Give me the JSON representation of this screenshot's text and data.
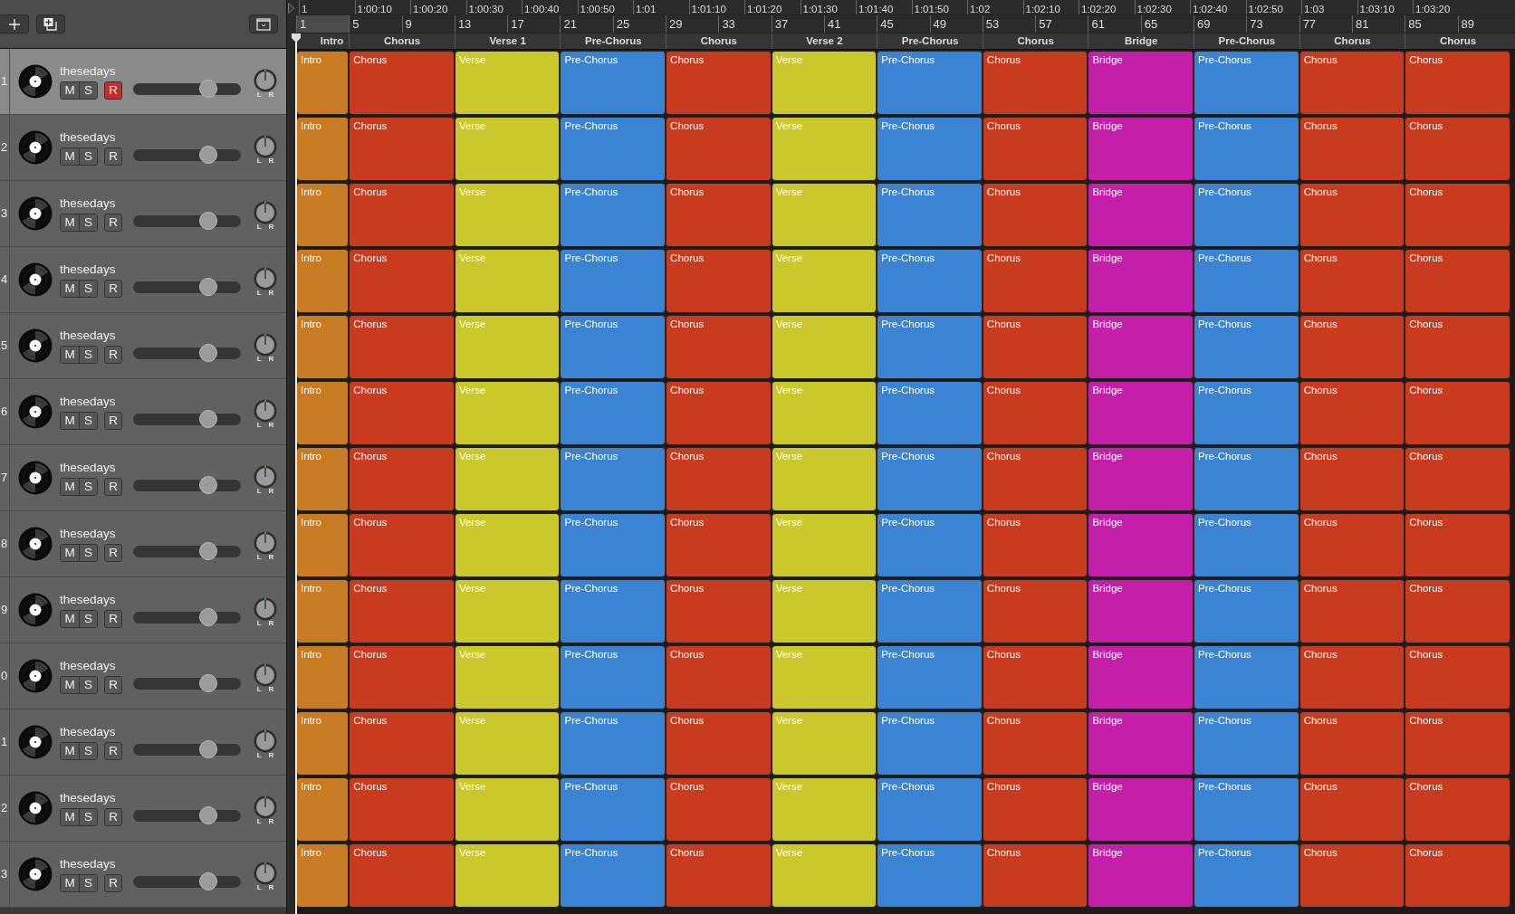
{
  "ruler": {
    "times": [
      "1",
      "1:00:10",
      "1:00:20",
      "1:00:30",
      "1:00:40",
      "1:00:50",
      "1:01",
      "1:01:10",
      "1:01:20",
      "1:01:30",
      "1:01:40",
      "1:01:50",
      "1:02",
      "1:02:10",
      "1:02:20",
      "1:02:30",
      "1:02:40",
      "1:02:50",
      "1:03",
      "1:03:10",
      "1:03:20"
    ],
    "bars": [
      "1",
      "5",
      "9",
      "13",
      "17",
      "21",
      "25",
      "29",
      "33",
      "37",
      "41",
      "45",
      "49",
      "53",
      "57",
      "61",
      "65",
      "69",
      "73",
      "77",
      "81",
      "85",
      "89"
    ]
  },
  "markers": [
    {
      "label": "Intro"
    },
    {
      "label": "Chorus"
    },
    {
      "label": "Verse 1"
    },
    {
      "label": "Pre-Chorus"
    },
    {
      "label": "Chorus"
    },
    {
      "label": "Verse 2"
    },
    {
      "label": "Pre-Chorus"
    },
    {
      "label": "Chorus"
    },
    {
      "label": "Bridge"
    },
    {
      "label": "Pre-Chorus"
    },
    {
      "label": "Chorus"
    },
    {
      "label": "Chorus"
    }
  ],
  "tracks": [
    {
      "number": "1",
      "name": "thesedays",
      "selected": true,
      "mute": {
        "label": "M",
        "on": false
      },
      "solo": {
        "label": "S",
        "on": false
      },
      "record": {
        "label": "R",
        "on": true
      },
      "volume": {
        "level": 0.7
      },
      "pan": {
        "left": "L",
        "right": "R"
      },
      "regions": [
        {
          "label": "Intro",
          "color": "#c87b22"
        },
        {
          "label": "Chorus",
          "color": "#c83b1e"
        },
        {
          "label": "Verse",
          "color": "#cbc82e"
        },
        {
          "label": "Pre-Chorus",
          "color": "#3a84d3"
        },
        {
          "label": "Chorus",
          "color": "#c83b1e"
        },
        {
          "label": "Verse",
          "color": "#cbc82e"
        },
        {
          "label": "Pre-Chorus",
          "color": "#3a84d3"
        },
        {
          "label": "Chorus",
          "color": "#c83b1e"
        },
        {
          "label": "Bridge",
          "color": "#c41fa8"
        },
        {
          "label": "Pre-Chorus",
          "color": "#3a84d3"
        },
        {
          "label": "Chorus",
          "color": "#c83b1e"
        },
        {
          "label": "Chorus",
          "color": "#c83b1e"
        }
      ]
    },
    {
      "number": "2",
      "name": "thesedays",
      "selected": false,
      "mute": {
        "label": "M",
        "on": false
      },
      "solo": {
        "label": "S",
        "on": false
      },
      "record": {
        "label": "R",
        "on": false
      },
      "volume": {
        "level": 0.7
      },
      "pan": {
        "left": "L",
        "right": "R"
      },
      "regions": [
        {
          "label": "Intro",
          "color": "#c87b22"
        },
        {
          "label": "Chorus",
          "color": "#c83b1e"
        },
        {
          "label": "Verse",
          "color": "#cbc82e"
        },
        {
          "label": "Pre-Chorus",
          "color": "#3a84d3"
        },
        {
          "label": "Chorus",
          "color": "#c83b1e"
        },
        {
          "label": "Verse",
          "color": "#cbc82e"
        },
        {
          "label": "Pre-Chorus",
          "color": "#3a84d3"
        },
        {
          "label": "Chorus",
          "color": "#c83b1e"
        },
        {
          "label": "Bridge",
          "color": "#c41fa8"
        },
        {
          "label": "Pre-Chorus",
          "color": "#3a84d3"
        },
        {
          "label": "Chorus",
          "color": "#c83b1e"
        },
        {
          "label": "Chorus",
          "color": "#c83b1e"
        }
      ]
    },
    {
      "number": "3",
      "name": "thesedays",
      "selected": false,
      "mute": {
        "label": "M",
        "on": false
      },
      "solo": {
        "label": "S",
        "on": false
      },
      "record": {
        "label": "R",
        "on": false
      },
      "volume": {
        "level": 0.7
      },
      "pan": {
        "left": "L",
        "right": "R"
      },
      "regions": [
        {
          "label": "Intro",
          "color": "#c87b22"
        },
        {
          "label": "Chorus",
          "color": "#c83b1e"
        },
        {
          "label": "Verse",
          "color": "#cbc82e"
        },
        {
          "label": "Pre-Chorus",
          "color": "#3a84d3"
        },
        {
          "label": "Chorus",
          "color": "#c83b1e"
        },
        {
          "label": "Verse",
          "color": "#cbc82e"
        },
        {
          "label": "Pre-Chorus",
          "color": "#3a84d3"
        },
        {
          "label": "Chorus",
          "color": "#c83b1e"
        },
        {
          "label": "Bridge",
          "color": "#c41fa8"
        },
        {
          "label": "Pre-Chorus",
          "color": "#3a84d3"
        },
        {
          "label": "Chorus",
          "color": "#c83b1e"
        },
        {
          "label": "Chorus",
          "color": "#c83b1e"
        }
      ]
    },
    {
      "number": "4",
      "name": "thesedays",
      "selected": false,
      "mute": {
        "label": "M",
        "on": false
      },
      "solo": {
        "label": "S",
        "on": false
      },
      "record": {
        "label": "R",
        "on": false
      },
      "volume": {
        "level": 0.7
      },
      "pan": {
        "left": "L",
        "right": "R"
      },
      "regions": [
        {
          "label": "Intro",
          "color": "#c87b22"
        },
        {
          "label": "Chorus",
          "color": "#c83b1e"
        },
        {
          "label": "Verse",
          "color": "#cbc82e"
        },
        {
          "label": "Pre-Chorus",
          "color": "#3a84d3"
        },
        {
          "label": "Chorus",
          "color": "#c83b1e"
        },
        {
          "label": "Verse",
          "color": "#cbc82e"
        },
        {
          "label": "Pre-Chorus",
          "color": "#3a84d3"
        },
        {
          "label": "Chorus",
          "color": "#c83b1e"
        },
        {
          "label": "Bridge",
          "color": "#c41fa8"
        },
        {
          "label": "Pre-Chorus",
          "color": "#3a84d3"
        },
        {
          "label": "Chorus",
          "color": "#c83b1e"
        },
        {
          "label": "Chorus",
          "color": "#c83b1e"
        }
      ]
    },
    {
      "number": "5",
      "name": "thesedays",
      "selected": false,
      "mute": {
        "label": "M",
        "on": false
      },
      "solo": {
        "label": "S",
        "on": false
      },
      "record": {
        "label": "R",
        "on": false
      },
      "volume": {
        "level": 0.7
      },
      "pan": {
        "left": "L",
        "right": "R"
      },
      "regions": [
        {
          "label": "Intro",
          "color": "#c87b22"
        },
        {
          "label": "Chorus",
          "color": "#c83b1e"
        },
        {
          "label": "Verse",
          "color": "#cbc82e"
        },
        {
          "label": "Pre-Chorus",
          "color": "#3a84d3"
        },
        {
          "label": "Chorus",
          "color": "#c83b1e"
        },
        {
          "label": "Verse",
          "color": "#cbc82e"
        },
        {
          "label": "Pre-Chorus",
          "color": "#3a84d3"
        },
        {
          "label": "Chorus",
          "color": "#c83b1e"
        },
        {
          "label": "Bridge",
          "color": "#c41fa8"
        },
        {
          "label": "Pre-Chorus",
          "color": "#3a84d3"
        },
        {
          "label": "Chorus",
          "color": "#c83b1e"
        },
        {
          "label": "Chorus",
          "color": "#c83b1e"
        }
      ]
    },
    {
      "number": "6",
      "name": "thesedays",
      "selected": false,
      "mute": {
        "label": "M",
        "on": false
      },
      "solo": {
        "label": "S",
        "on": false
      },
      "record": {
        "label": "R",
        "on": false
      },
      "volume": {
        "level": 0.7
      },
      "pan": {
        "left": "L",
        "right": "R"
      },
      "regions": [
        {
          "label": "Intro",
          "color": "#c87b22"
        },
        {
          "label": "Chorus",
          "color": "#c83b1e"
        },
        {
          "label": "Verse",
          "color": "#cbc82e"
        },
        {
          "label": "Pre-Chorus",
          "color": "#3a84d3"
        },
        {
          "label": "Chorus",
          "color": "#c83b1e"
        },
        {
          "label": "Verse",
          "color": "#cbc82e"
        },
        {
          "label": "Pre-Chorus",
          "color": "#3a84d3"
        },
        {
          "label": "Chorus",
          "color": "#c83b1e"
        },
        {
          "label": "Bridge",
          "color": "#c41fa8"
        },
        {
          "label": "Pre-Chorus",
          "color": "#3a84d3"
        },
        {
          "label": "Chorus",
          "color": "#c83b1e"
        },
        {
          "label": "Chorus",
          "color": "#c83b1e"
        }
      ]
    },
    {
      "number": "7",
      "name": "thesedays",
      "selected": false,
      "mute": {
        "label": "M",
        "on": false
      },
      "solo": {
        "label": "S",
        "on": false
      },
      "record": {
        "label": "R",
        "on": false
      },
      "volume": {
        "level": 0.7
      },
      "pan": {
        "left": "L",
        "right": "R"
      },
      "regions": [
        {
          "label": "Intro",
          "color": "#c87b22"
        },
        {
          "label": "Chorus",
          "color": "#c83b1e"
        },
        {
          "label": "Verse",
          "color": "#cbc82e"
        },
        {
          "label": "Pre-Chorus",
          "color": "#3a84d3"
        },
        {
          "label": "Chorus",
          "color": "#c83b1e"
        },
        {
          "label": "Verse",
          "color": "#cbc82e"
        },
        {
          "label": "Pre-Chorus",
          "color": "#3a84d3"
        },
        {
          "label": "Chorus",
          "color": "#c83b1e"
        },
        {
          "label": "Bridge",
          "color": "#c41fa8"
        },
        {
          "label": "Pre-Chorus",
          "color": "#3a84d3"
        },
        {
          "label": "Chorus",
          "color": "#c83b1e"
        },
        {
          "label": "Chorus",
          "color": "#c83b1e"
        }
      ]
    },
    {
      "number": "8",
      "name": "thesedays",
      "selected": false,
      "mute": {
        "label": "M",
        "on": false
      },
      "solo": {
        "label": "S",
        "on": false
      },
      "record": {
        "label": "R",
        "on": false
      },
      "volume": {
        "level": 0.7
      },
      "pan": {
        "left": "L",
        "right": "R"
      },
      "regions": [
        {
          "label": "Intro",
          "color": "#c87b22"
        },
        {
          "label": "Chorus",
          "color": "#c83b1e"
        },
        {
          "label": "Verse",
          "color": "#cbc82e"
        },
        {
          "label": "Pre-Chorus",
          "color": "#3a84d3"
        },
        {
          "label": "Chorus",
          "color": "#c83b1e"
        },
        {
          "label": "Verse",
          "color": "#cbc82e"
        },
        {
          "label": "Pre-Chorus",
          "color": "#3a84d3"
        },
        {
          "label": "Chorus",
          "color": "#c83b1e"
        },
        {
          "label": "Bridge",
          "color": "#c41fa8"
        },
        {
          "label": "Pre-Chorus",
          "color": "#3a84d3"
        },
        {
          "label": "Chorus",
          "color": "#c83b1e"
        },
        {
          "label": "Chorus",
          "color": "#c83b1e"
        }
      ]
    },
    {
      "number": "9",
      "name": "thesedays",
      "selected": false,
      "mute": {
        "label": "M",
        "on": false
      },
      "solo": {
        "label": "S",
        "on": false
      },
      "record": {
        "label": "R",
        "on": false
      },
      "volume": {
        "level": 0.7
      },
      "pan": {
        "left": "L",
        "right": "R"
      },
      "regions": [
        {
          "label": "Intro",
          "color": "#c87b22"
        },
        {
          "label": "Chorus",
          "color": "#c83b1e"
        },
        {
          "label": "Verse",
          "color": "#cbc82e"
        },
        {
          "label": "Pre-Chorus",
          "color": "#3a84d3"
        },
        {
          "label": "Chorus",
          "color": "#c83b1e"
        },
        {
          "label": "Verse",
          "color": "#cbc82e"
        },
        {
          "label": "Pre-Chorus",
          "color": "#3a84d3"
        },
        {
          "label": "Chorus",
          "color": "#c83b1e"
        },
        {
          "label": "Bridge",
          "color": "#c41fa8"
        },
        {
          "label": "Pre-Chorus",
          "color": "#3a84d3"
        },
        {
          "label": "Chorus",
          "color": "#c83b1e"
        },
        {
          "label": "Chorus",
          "color": "#c83b1e"
        }
      ]
    },
    {
      "number": "0",
      "name": "thesedays",
      "selected": false,
      "mute": {
        "label": "M",
        "on": false
      },
      "solo": {
        "label": "S",
        "on": false
      },
      "record": {
        "label": "R",
        "on": false
      },
      "volume": {
        "level": 0.7
      },
      "pan": {
        "left": "L",
        "right": "R"
      },
      "regions": [
        {
          "label": "Intro",
          "color": "#c87b22"
        },
        {
          "label": "Chorus",
          "color": "#c83b1e"
        },
        {
          "label": "Verse",
          "color": "#cbc82e"
        },
        {
          "label": "Pre-Chorus",
          "color": "#3a84d3"
        },
        {
          "label": "Chorus",
          "color": "#c83b1e"
        },
        {
          "label": "Verse",
          "color": "#cbc82e"
        },
        {
          "label": "Pre-Chorus",
          "color": "#3a84d3"
        },
        {
          "label": "Chorus",
          "color": "#c83b1e"
        },
        {
          "label": "Bridge",
          "color": "#c41fa8"
        },
        {
          "label": "Pre-Chorus",
          "color": "#3a84d3"
        },
        {
          "label": "Chorus",
          "color": "#c83b1e"
        },
        {
          "label": "Chorus",
          "color": "#c83b1e"
        }
      ]
    },
    {
      "number": "1",
      "name": "thesedays",
      "selected": false,
      "mute": {
        "label": "M",
        "on": false
      },
      "solo": {
        "label": "S",
        "on": false
      },
      "record": {
        "label": "R",
        "on": false
      },
      "volume": {
        "level": 0.7
      },
      "pan": {
        "left": "L",
        "right": "R"
      },
      "regions": [
        {
          "label": "Intro",
          "color": "#c87b22"
        },
        {
          "label": "Chorus",
          "color": "#c83b1e"
        },
        {
          "label": "Verse",
          "color": "#cbc82e"
        },
        {
          "label": "Pre-Chorus",
          "color": "#3a84d3"
        },
        {
          "label": "Chorus",
          "color": "#c83b1e"
        },
        {
          "label": "Verse",
          "color": "#cbc82e"
        },
        {
          "label": "Pre-Chorus",
          "color": "#3a84d3"
        },
        {
          "label": "Chorus",
          "color": "#c83b1e"
        },
        {
          "label": "Bridge",
          "color": "#c41fa8"
        },
        {
          "label": "Pre-Chorus",
          "color": "#3a84d3"
        },
        {
          "label": "Chorus",
          "color": "#c83b1e"
        },
        {
          "label": "Chorus",
          "color": "#c83b1e"
        }
      ]
    },
    {
      "number": "2",
      "name": "thesedays",
      "selected": false,
      "mute": {
        "label": "M",
        "on": false
      },
      "solo": {
        "label": "S",
        "on": false
      },
      "record": {
        "label": "R",
        "on": false
      },
      "volume": {
        "level": 0.7
      },
      "pan": {
        "left": "L",
        "right": "R"
      },
      "regions": [
        {
          "label": "Intro",
          "color": "#c87b22"
        },
        {
          "label": "Chorus",
          "color": "#c83b1e"
        },
        {
          "label": "Verse",
          "color": "#cbc82e"
        },
        {
          "label": "Pre-Chorus",
          "color": "#3a84d3"
        },
        {
          "label": "Chorus",
          "color": "#c83b1e"
        },
        {
          "label": "Verse",
          "color": "#cbc82e"
        },
        {
          "label": "Pre-Chorus",
          "color": "#3a84d3"
        },
        {
          "label": "Chorus",
          "color": "#c83b1e"
        },
        {
          "label": "Bridge",
          "color": "#c41fa8"
        },
        {
          "label": "Pre-Chorus",
          "color": "#3a84d3"
        },
        {
          "label": "Chorus",
          "color": "#c83b1e"
        },
        {
          "label": "Chorus",
          "color": "#c83b1e"
        }
      ]
    },
    {
      "number": "3",
      "name": "thesedays",
      "selected": false,
      "mute": {
        "label": "M",
        "on": false
      },
      "solo": {
        "label": "S",
        "on": false
      },
      "record": {
        "label": "R",
        "on": false
      },
      "volume": {
        "level": 0.7
      },
      "pan": {
        "left": "L",
        "right": "R"
      },
      "regions": [
        {
          "label": "Intro",
          "color": "#c87b22"
        },
        {
          "label": "Chorus",
          "color": "#c83b1e"
        },
        {
          "label": "Verse",
          "color": "#cbc82e"
        },
        {
          "label": "Pre-Chorus",
          "color": "#3a84d3"
        },
        {
          "label": "Chorus",
          "color": "#c83b1e"
        },
        {
          "label": "Verse",
          "color": "#cbc82e"
        },
        {
          "label": "Pre-Chorus",
          "color": "#3a84d3"
        },
        {
          "label": "Chorus",
          "color": "#c83b1e"
        },
        {
          "label": "Bridge",
          "color": "#c41fa8"
        },
        {
          "label": "Pre-Chorus",
          "color": "#3a84d3"
        },
        {
          "label": "Chorus",
          "color": "#c83b1e"
        },
        {
          "label": "Chorus",
          "color": "#c83b1e"
        }
      ]
    }
  ]
}
